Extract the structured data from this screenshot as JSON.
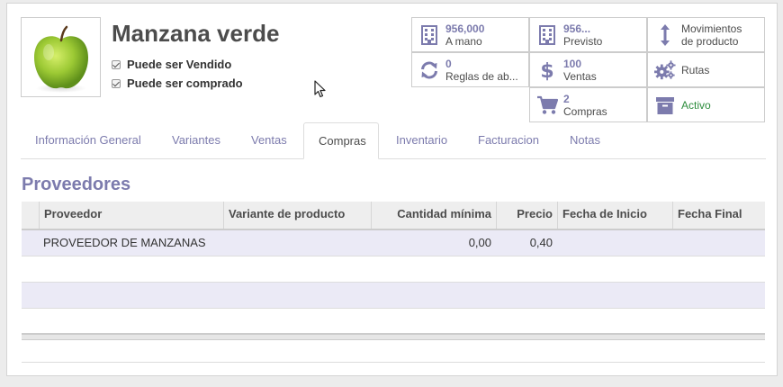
{
  "product": {
    "name": "Manzana verde",
    "can_be_sold_label": "Puede ser Vendido",
    "can_be_purchased_label": "Puede ser comprado"
  },
  "stat_buttons": [
    {
      "id": "on_hand",
      "value": "956,000",
      "label": "A mano",
      "icon": "building-icon"
    },
    {
      "id": "forecast",
      "value": "956...",
      "label": "Previsto",
      "icon": "building-icon"
    },
    {
      "id": "moves",
      "value": "",
      "label": "Movimientos",
      "label2": "de producto",
      "icon": "up-down-arrow-icon"
    },
    {
      "id": "reorder",
      "value": "0",
      "label": "Reglas de ab...",
      "icon": "refresh-icon"
    },
    {
      "id": "sales",
      "value": "100",
      "label": "Ventas",
      "icon": "dollar-icon"
    },
    {
      "id": "routes",
      "value": "",
      "label": "Rutas",
      "icon": "gears-icon"
    },
    {
      "id": "purchases",
      "value": "2",
      "label": "Compras",
      "icon": "cart-icon"
    },
    {
      "id": "active",
      "value": "",
      "label": "Activo",
      "icon": "archive-icon"
    }
  ],
  "tabs": [
    {
      "label": "Información General"
    },
    {
      "label": "Variantes"
    },
    {
      "label": "Ventas"
    },
    {
      "label": "Compras",
      "active": true
    },
    {
      "label": "Inventario"
    },
    {
      "label": "Facturacion"
    },
    {
      "label": "Notas"
    }
  ],
  "vendors": {
    "title": "Proveedores",
    "columns": [
      "Proveedor",
      "Variante de producto",
      "Cantidad mínima",
      "Precio",
      "Fecha de Inicio",
      "Fecha Final"
    ],
    "rows": [
      {
        "vendor": "PROVEEDOR DE MANZANAS",
        "variant": "",
        "min_qty": "0,00",
        "price": "0,40",
        "date_start": "",
        "date_end": ""
      }
    ]
  },
  "colors": {
    "accent": "#7c7bad",
    "active_green": "#2c8c3c",
    "row_alt": "#ebeaf6"
  }
}
